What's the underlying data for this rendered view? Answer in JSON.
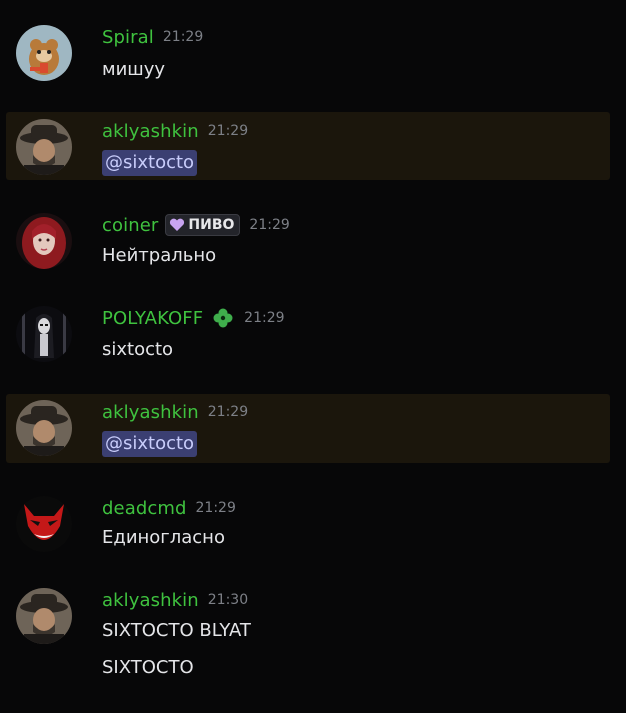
{
  "messages": [
    {
      "username": "Spiral",
      "time": "21:29",
      "text": "мишуу"
    },
    {
      "username": "aklyashkin",
      "time": "21:29",
      "mention": "@sixtocto"
    },
    {
      "username": "coiner",
      "time": "21:29",
      "tag": "ПИВО",
      "text": "Нейтрально"
    },
    {
      "username": "POLYAKOFF",
      "time": "21:29",
      "text": "sixtocto"
    },
    {
      "username": "aklyashkin",
      "time": "21:29",
      "mention": "@sixtocto"
    },
    {
      "username": "deadcmd",
      "time": "21:29",
      "text": "Единогласно"
    },
    {
      "username": "aklyashkin",
      "time": "21:30",
      "text": "SIXTOCTO BLYAT",
      "text2": "SIXTOCTO"
    }
  ],
  "colors": {
    "background": "#070708",
    "username": "#3fc23f",
    "mention_highlight": "#1b160c",
    "mention_pill": "#3b3f72"
  },
  "icons": [
    "beaver-avatar",
    "man-in-hat-avatar",
    "red-hair-avatar",
    "dark-figure-avatar",
    "red-devil-mask-avatar",
    "heart-icon",
    "clover-icon"
  ]
}
